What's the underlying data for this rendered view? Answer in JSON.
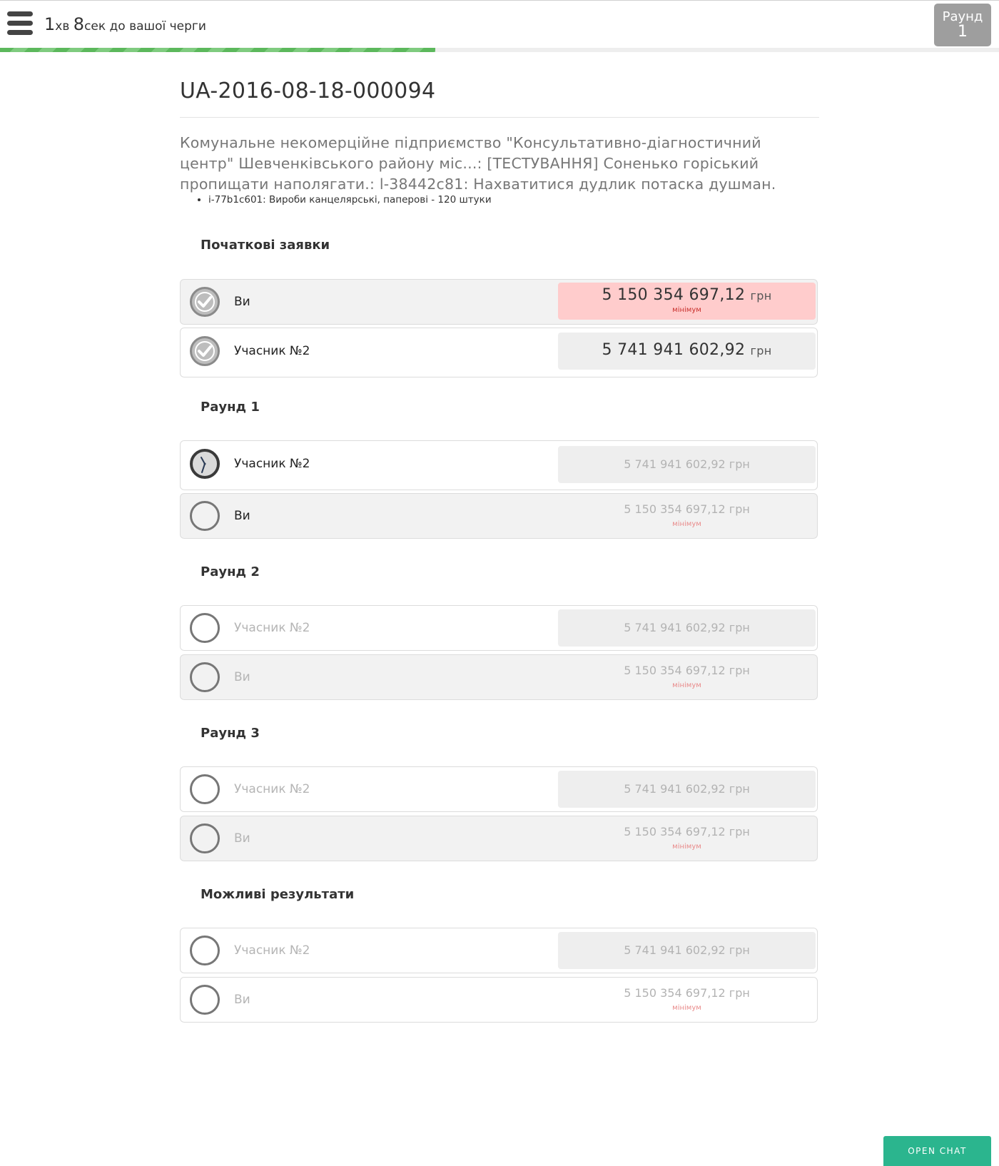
{
  "header": {
    "timer_min": "1",
    "timer_min_unit": "хв",
    "timer_sec": "8",
    "timer_rest": "сек до вашої черги",
    "round_label": "Раунд",
    "round_number": "1",
    "progress_percent": 43.6
  },
  "tender": {
    "id": "UA-2016-08-18-000094",
    "description": "Комунальне некомерційне підприємство \"Консультативно-діагностичний центр\" Шевченківського району міс...: [ТЕСТУВАННЯ] Соненько горіський пропищати наполягати.: l-38442c81: Нахватитися дудлик потаска душман.",
    "items": [
      "i-77b1c601: Вироби канцелярські, паперові - 120 штуки"
    ]
  },
  "currency": "грн",
  "min_label": "мінімум",
  "sections": [
    {
      "title": "Початкові заявки",
      "rows": [
        {
          "bidder": "Ви",
          "amount": "5 150 354 697,12"
        },
        {
          "bidder": "Учасник №2",
          "amount": "5 741 941 602,92"
        }
      ]
    },
    {
      "title": "Раунд 1",
      "rows": [
        {
          "bidder": "Учасник №2",
          "amount": "5 741 941 602,92"
        },
        {
          "bidder": "Ви",
          "amount": "5 150 354 697,12"
        }
      ]
    },
    {
      "title": "Раунд 2",
      "rows": [
        {
          "bidder": "Учасник №2",
          "amount": "5 741 941 602,92"
        },
        {
          "bidder": "Ви",
          "amount": "5 150 354 697,12"
        }
      ]
    },
    {
      "title": "Раунд 3",
      "rows": [
        {
          "bidder": "Учасник №2",
          "amount": "5 741 941 602,92"
        },
        {
          "bidder": "Ви",
          "amount": "5 150 354 697,12"
        }
      ]
    },
    {
      "title": "Можливі результати",
      "rows": [
        {
          "bidder": "Учасник №2",
          "amount": "5 741 941 602,92"
        },
        {
          "bidder": "Ви",
          "amount": "5 150 354 697,12"
        }
      ]
    }
  ],
  "chat": {
    "label": "OPEN CHAT"
  },
  "colors": {
    "progress": "#5cb85c",
    "min_highlight": "#ffcccc",
    "chat_button": "#2bb58e",
    "round_badge": "#9e9e9e"
  },
  "icons": [
    "menu-icon",
    "check-icon",
    "clock-icon",
    "empty-circle-icon"
  ]
}
